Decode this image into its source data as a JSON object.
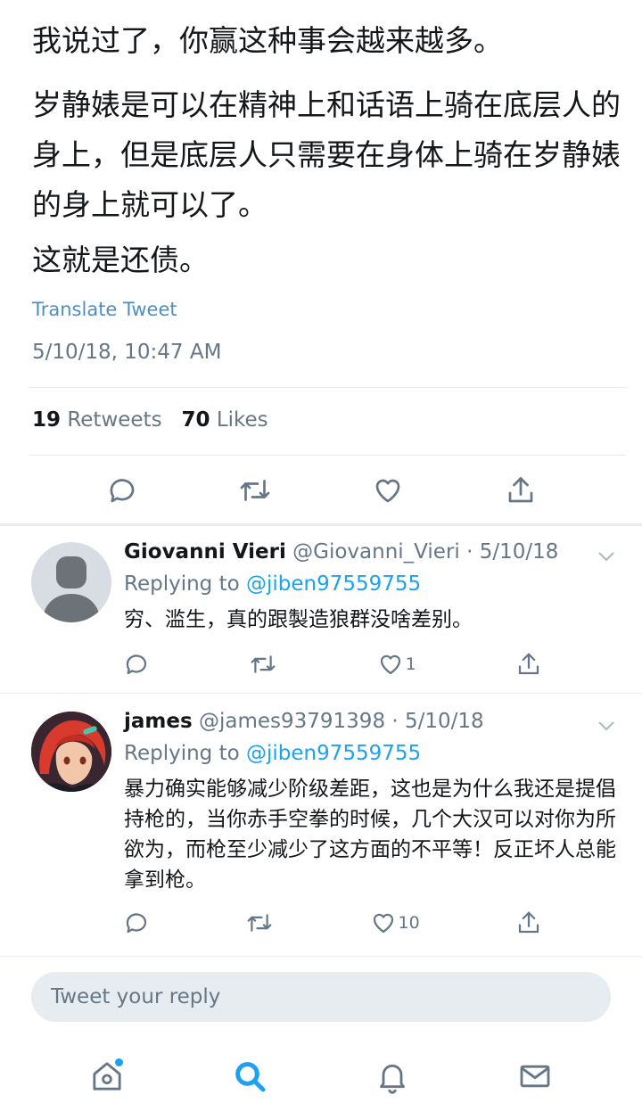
{
  "tweet": {
    "paragraphs": [
      "我说过了，你赢这种事会越来越多。",
      "岁静婊是可以在精神上和话语上骑在底层人的身上，但是底层人只需要在身体上骑在岁静婊的身上就可以了。",
      "这就是还债。"
    ],
    "translate_label": "Translate Tweet",
    "timestamp": "5/10/18, 10:47 AM",
    "retweets_count": "19",
    "retweets_label": "Retweets",
    "likes_count": "70",
    "likes_label": "Likes"
  },
  "icons": {
    "reply": "reply-icon",
    "retweet": "retweet-icon",
    "like": "heart-icon",
    "share": "share-icon",
    "home": "home-icon",
    "search": "search-icon",
    "notifications": "bell-icon",
    "messages": "mail-icon",
    "more": "chevron-down-icon"
  },
  "colors": {
    "accent": "#1da1f2",
    "muted": "#657786",
    "text": "#14171a",
    "divider": "#e6ecf0"
  },
  "replies": [
    {
      "name": "Giovanni Vieri",
      "handle": "@Giovanni_Vieri",
      "date": "· 5/10/18",
      "replying_prefix": "Replying to",
      "replying_to": "@jiben97559755",
      "text": "穷、滥生，真的跟製造狼群没啥差别。",
      "likes": "1"
    },
    {
      "name": "james",
      "handle": "@james93791398",
      "date": "· 5/10/18",
      "replying_prefix": "Replying to",
      "replying_to": "@jiben97559755",
      "text": "暴力确实能够减少阶级差距，这也是为什么我还是提倡持枪的，当你赤手空拳的时候，几个大汉可以对你为所欲为，而枪至少减少了这方面的不平等！反正坏人总能拿到枪。",
      "likes": "10"
    }
  ],
  "compose": {
    "placeholder": "Tweet your reply"
  }
}
